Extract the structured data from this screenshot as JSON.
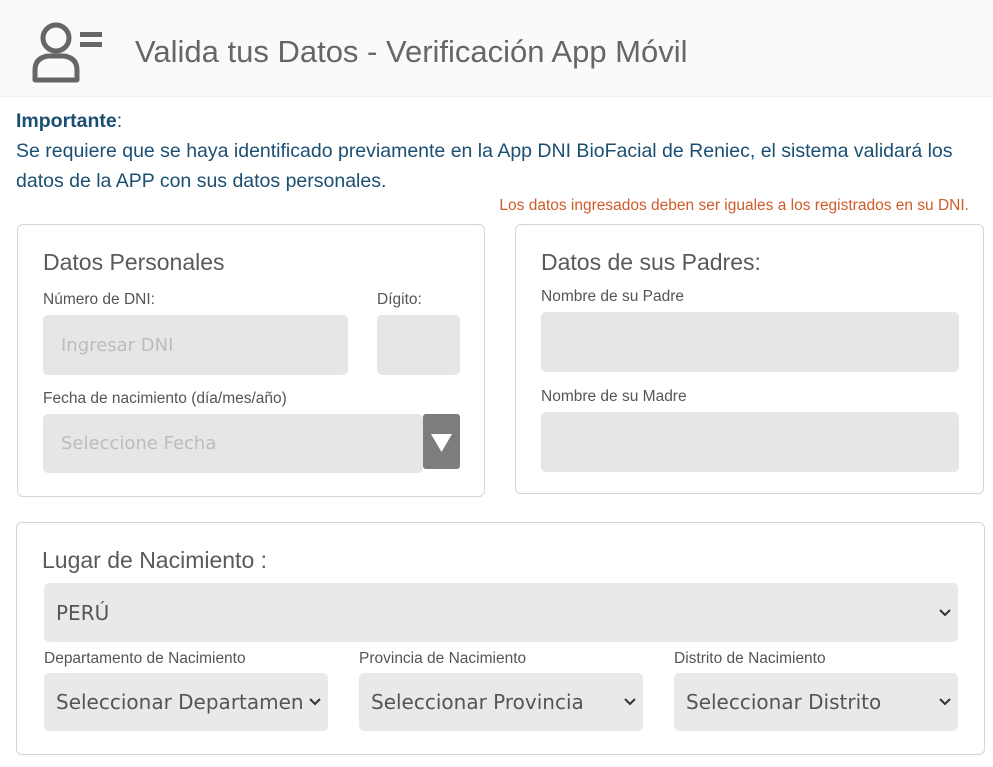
{
  "header": {
    "title": "Valida tus Datos - Verificación App Móvil",
    "icon": "user-list-icon"
  },
  "notice": {
    "important_label": "Importante",
    "colon": ":",
    "body": "Se requiere que se haya identificado previamente en la App DNI BioFacial de Reniec, el sistema validará los datos de la APP con sus datos personales."
  },
  "warning": "Los datos ingresados deben ser iguales a los registrados en su DNI.",
  "personal": {
    "title": "Datos Personales",
    "dni_label": "Número de DNI:",
    "dni_placeholder": "Ingresar DNI",
    "digit_label": "Dígito:",
    "digit_value": "",
    "birth_label": "Fecha de nacimiento (día/mes/año)",
    "birth_placeholder": "Seleccione Fecha"
  },
  "parents": {
    "title": "Datos de sus Padres:",
    "father_label": "Nombre de su Padre",
    "father_value": "",
    "mother_label": "Nombre de su Madre",
    "mother_value": ""
  },
  "birthplace": {
    "title": "Lugar de Nacimiento :",
    "country_value": "PERÚ",
    "department_label": "Departamento de Nacimiento",
    "department_value": "Seleccionar Departamento",
    "province_label": "Provincia de Nacimiento",
    "province_value": "Seleccionar Provincia",
    "district_label": "Distrito de Nacimiento",
    "district_value": "Seleccionar Distrito"
  },
  "colors": {
    "notice_text": "#1b4f72",
    "warning_text": "#d05a28",
    "field_bg": "#e6e6e6",
    "date_button": "#7d7d7d"
  }
}
